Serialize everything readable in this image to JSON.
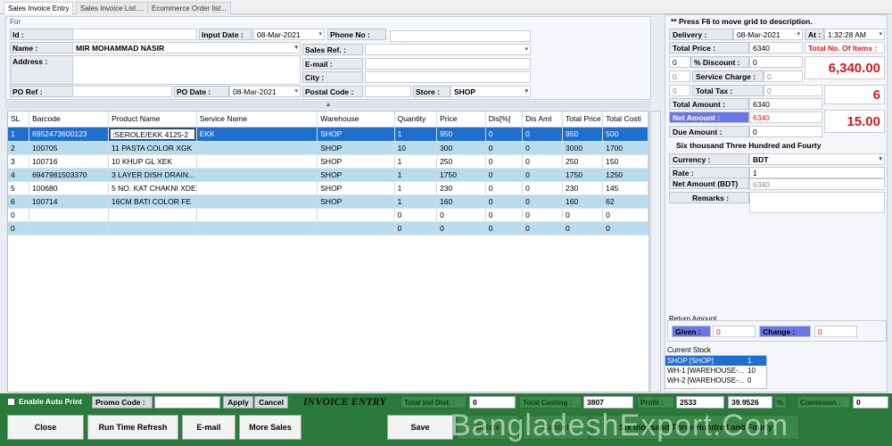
{
  "tabs": [
    "Sales Invoice Entry",
    "Sales Invoice List....",
    "Ecommerce Order list..."
  ],
  "header_form": {
    "section_label": "For",
    "id_label": "Id :",
    "id_value": "",
    "input_date_label": "Input Date :",
    "input_date_value": "08-Mar-2021",
    "phone_label": "Phone No :",
    "phone_value": "",
    "name_label": "Name :",
    "name_value": "MIR MOHAMMAD NASIR",
    "sales_ref_label": "Sales Ref. :",
    "sales_ref_value": "",
    "address_label": "Address :",
    "email_label": "E-mail :",
    "city_label": "City :",
    "po_ref_label": "PO Ref :",
    "po_date_label": "PO Date :",
    "po_date_value": "08-Mar-2021",
    "postal_label": "Postal Code :",
    "store_label": "Store :",
    "store_value": "SHOP"
  },
  "grid": {
    "columns": [
      "SL",
      "Barcode",
      "Product Name",
      "Service Name",
      "Warehouse",
      "Quantity",
      "Price",
      "Dis[%]",
      "Dis Amt",
      "Total Price",
      "Total Costi"
    ],
    "rows": [
      [
        "1",
        "6952473600123",
        ";SEROLE/EKK 4125-2",
        "EKK",
        "SHOP",
        "1",
        "950",
        "0",
        "0",
        "950",
        "500"
      ],
      [
        "2",
        "100705",
        "11 PASTA COLOR XGK",
        "",
        "SHOP",
        "10",
        "300",
        "0",
        "0",
        "3000",
        "1700"
      ],
      [
        "3",
        "100716",
        "10 KHUP GL XEK",
        "",
        "SHOP",
        "1",
        "250",
        "0",
        "0",
        "250",
        "150"
      ],
      [
        "4",
        "6947981503370",
        "3 LAYER DISH DRAIN...",
        "",
        "SHOP",
        "1",
        "1750",
        "0",
        "0",
        "1750",
        "1250"
      ],
      [
        "5",
        "100680",
        "5 NO. KAT CHAKNI XDE",
        "",
        "SHOP",
        "1",
        "230",
        "0",
        "0",
        "230",
        "145"
      ],
      [
        "6",
        "100714",
        "16CM BATI COLOR FE",
        "",
        "SHOP",
        "1",
        "160",
        "0",
        "0",
        "160",
        "62"
      ],
      [
        "0",
        "",
        "",
        "",
        "",
        "0",
        "0",
        "0",
        "0",
        "0",
        "0"
      ],
      [
        "0",
        "",
        "",
        "",
        "",
        "0",
        "0",
        "0",
        "0",
        "0",
        "0"
      ]
    ]
  },
  "right_panel": {
    "hint": "** Press F6 to move grid to description.",
    "delivery_label": "Delivery :",
    "delivery_value": "08-Mar-2021",
    "at_label": "At :",
    "at_value": "1:32:28 AM",
    "total_price_label": "Total Price :",
    "total_price_value": "6340",
    "total_items_label": "Total No. Of Items :",
    "discount_left": "0",
    "discount_label": "% Discount :",
    "discount_value": "0",
    "big_total": "6,340.00",
    "service_left": "0",
    "service_label": "Service Charge :",
    "service_value": "0",
    "tax_left": "0",
    "tax_label": "Total Tax :",
    "tax_value": "0",
    "items_count": "6",
    "total_amount_label": "Total Amount :",
    "total_amount_value": "6340",
    "net_amount_label": "Net Amount :",
    "net_amount_value": "6340",
    "big_qty": "15.00",
    "due_label": "Due Amount :",
    "due_value": "0",
    "in_words": "Six thousand Three Hundred and Fourty",
    "currency_label": "Currency :",
    "currency_value": "BDT",
    "rate_label": "Rate :",
    "rate_value": "1",
    "net_bdt_label": "Net Amount (BDT)",
    "net_bdt_value": "6340",
    "remarks_label": "Remarks :",
    "return_amount_label": "Return Amount",
    "given_label": "Given :",
    "given_value": "0",
    "change_label": "Change :",
    "change_value": "0",
    "current_stock_label": "Current Stock",
    "stock": [
      [
        "SHOP [SHOP]",
        "1"
      ],
      [
        "WH-1 [WAREHOUSE-...",
        "10"
      ],
      [
        "WH-2 [WAREHOUSE-...",
        "0"
      ]
    ]
  },
  "status_bar": {
    "auto_print": "Enable Auto Print",
    "promo_label": "Promo Code :",
    "apply": "Apply",
    "cancel": "Cancel",
    "invoice_entry": "INVOICE ENTRY",
    "total_ind_dist_label": "Total Ind Dist. :",
    "total_ind_dist_value": "0",
    "total_costing_label": "Total Costing :",
    "total_costing_value": "3807",
    "profit_label": "Profit :",
    "profit_value": "2533",
    "profit_pct": "39.9526",
    "pct_sign": "%",
    "comission_label": "Comission :",
    "comission_value": "0"
  },
  "buttons": {
    "close": "Close",
    "refresh": "Run Time Refresh",
    "email": "E-mail",
    "more_sales": "More Sales",
    "save": "Save",
    "delete": "Delete",
    "cancel": "Cancel",
    "words": "Six thousand Three Hundred and Fourty"
  },
  "watermark": "BangladeshExport.Com"
}
